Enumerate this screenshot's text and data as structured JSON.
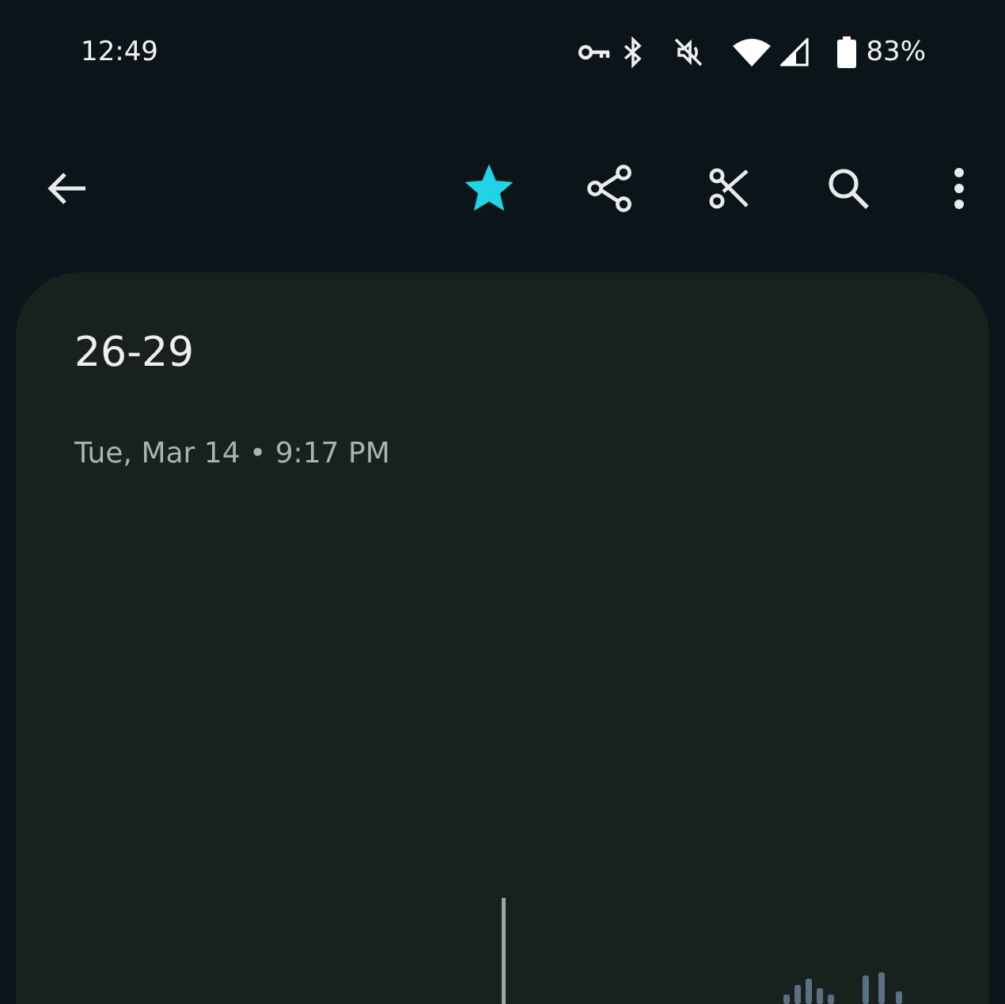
{
  "status_bar": {
    "time": "12:49",
    "battery": "83%"
  },
  "toolbar": {
    "starred": true
  },
  "recording": {
    "title": "26-29",
    "date": "Tue, Mar 14 • 9:17 PM"
  }
}
